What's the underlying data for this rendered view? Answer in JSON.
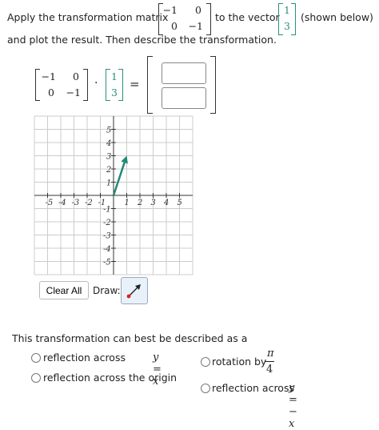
{
  "prompt": {
    "part1": "Apply the transformation matrix",
    "part2": "to the vector",
    "part3": "(shown below)",
    "line2": "and plot the result. Then describe the transformation."
  },
  "matrix": {
    "a": "−1",
    "b": "0",
    "c": "0",
    "d": "−1"
  },
  "vector": {
    "x": "1",
    "y": "3"
  },
  "equation": {
    "dot": "·",
    "equals": "="
  },
  "answer": {
    "top": "",
    "bottom": ""
  },
  "graph": {
    "x_ticks": [
      "-5",
      "-4",
      "-3",
      "-2",
      "-1",
      "1",
      "2",
      "3",
      "4",
      "5"
    ],
    "y_ticks_pos": [
      "5",
      "4",
      "3",
      "2",
      "1"
    ],
    "y_ticks_neg": [
      "-1",
      "-2",
      "-3",
      "-4",
      "-5"
    ],
    "arrow": {
      "from": [
        0,
        0
      ],
      "to": [
        1,
        3
      ]
    },
    "arrow_color": "#1f8a76"
  },
  "controls": {
    "clear_all": "Clear All",
    "draw": "Draw:"
  },
  "question": "This transformation can best be described as a",
  "options": {
    "o1_text": "reflection across ",
    "o1_math": "y = x",
    "o2_text": "reflection across the origin",
    "o3_text": "rotation by",
    "o3_num": "π",
    "o3_den": "4",
    "o4_text": "reflection across ",
    "o4_math": "y = − x"
  }
}
